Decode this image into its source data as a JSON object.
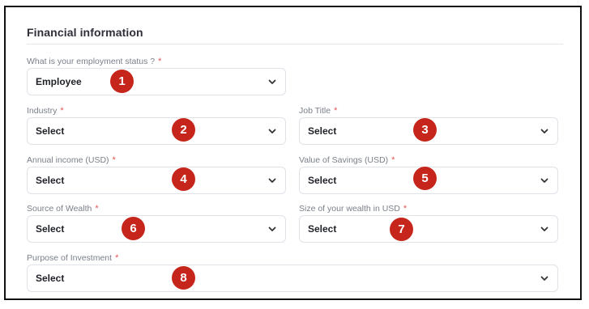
{
  "section": {
    "title": "Financial information"
  },
  "fields": [
    {
      "label": "What is your employment status ?",
      "required": "*",
      "value": "Employee",
      "marker": "1"
    },
    {
      "label": "Industry",
      "required": "*",
      "value": "Select",
      "marker": "2"
    },
    {
      "label": "Job Title",
      "required": "*",
      "value": "Select",
      "marker": "3"
    },
    {
      "label": "Annual income (USD)",
      "required": "*",
      "value": "Select",
      "marker": "4"
    },
    {
      "label": "Value of Savings (USD)",
      "required": "*",
      "value": "Select",
      "marker": "5"
    },
    {
      "label": "Source of Wealth",
      "required": "*",
      "value": "Select",
      "marker": "6"
    },
    {
      "label": "Size of your wealth in USD",
      "required": "*",
      "value": "Select",
      "marker": "7"
    },
    {
      "label": "Purpose of Investment",
      "required": "*",
      "value": "Select",
      "marker": "8"
    }
  ],
  "icons": {
    "dropdown": "chevron-down-icon"
  },
  "colors": {
    "marker": "#c5251b",
    "required": "#e25555",
    "title": "#2f2f3a"
  }
}
